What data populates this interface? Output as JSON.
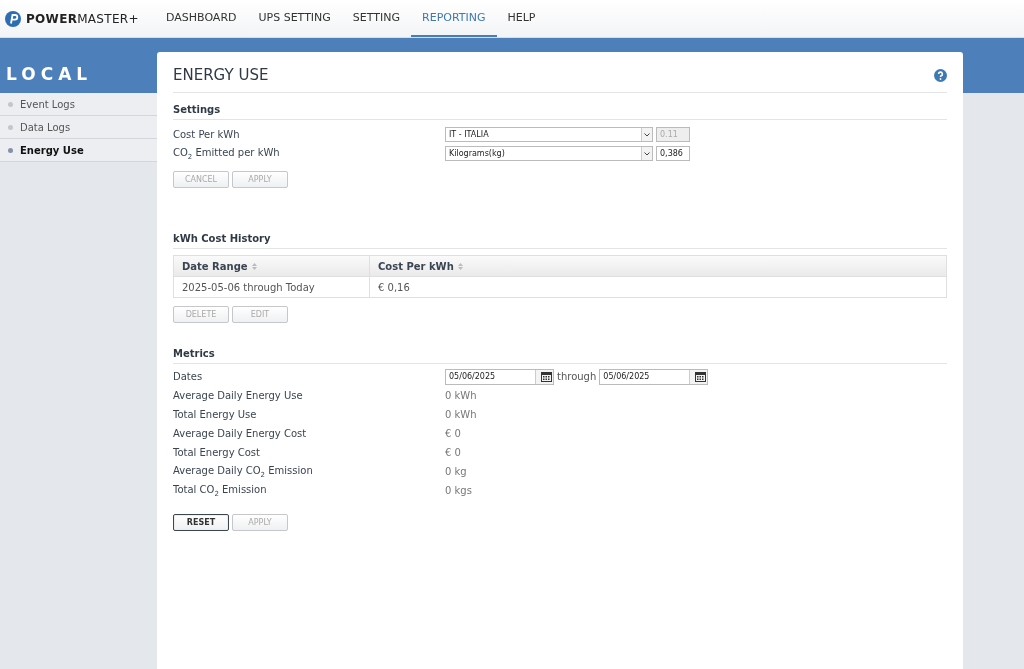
{
  "brand": {
    "name": "**POWER**MASTER+"
  },
  "nav": [
    {
      "label": "DASHBOARD",
      "selected": false
    },
    {
      "label": "UPS SETTING",
      "selected": false
    },
    {
      "label": "SETTING",
      "selected": false
    },
    {
      "label": "REPORTING",
      "selected": true
    },
    {
      "label": "HELP",
      "selected": false
    }
  ],
  "sidebar": {
    "title": "LOCAL",
    "items": [
      {
        "label": "Event Logs",
        "selected": false
      },
      {
        "label": "Data Logs",
        "selected": false
      },
      {
        "label": "Energy Use",
        "selected": true
      }
    ]
  },
  "page": {
    "title": "ENERGY USE"
  },
  "settings": {
    "heading": "Settings",
    "rows": [
      {
        "label": "Cost Per kWh",
        "select": "IT - ITALIA",
        "value": "0.11",
        "disabled": true
      },
      {
        "label": "CO$_{2}$ Emitted per kWh",
        "select": "Kilograms(kg)",
        "value": "0,386",
        "disabled": false
      }
    ],
    "buttons": [
      {
        "label": "CANCEL",
        "disabled": true
      },
      {
        "label": "APPLY",
        "disabled": true
      }
    ]
  },
  "history": {
    "heading": "kWh Cost History",
    "columns": [
      "Date Range",
      "Cost Per kWh"
    ],
    "rows": [
      [
        "2025-05-06 through Today",
        "€ 0,16"
      ]
    ],
    "buttons": [
      {
        "label": "DELETE",
        "disabled": true
      },
      {
        "label": "EDIT",
        "disabled": true
      }
    ]
  },
  "metrics": {
    "heading": "Metrics",
    "dates_label": "Dates",
    "date_from": "05/06/2025",
    "through": "through",
    "date_to": "05/06/2025",
    "rows": [
      {
        "label": "Average Daily Energy Use",
        "value": "0 kWh"
      },
      {
        "label": "Total Energy Use",
        "value": "0 kWh"
      },
      {
        "label": "Average Daily Energy Cost",
        "value": "€ 0"
      },
      {
        "label": "Total Energy Cost",
        "value": "€ 0"
      },
      {
        "label": "Average Daily CO$_{2}$ Emission",
        "value": "0 kg"
      },
      {
        "label": "Total CO$_{2}$ Emission",
        "value": "0 kgs"
      }
    ],
    "buttons": [
      {
        "label": "RESET",
        "disabled": false
      },
      {
        "label": "APPLY",
        "disabled": true
      }
    ]
  }
}
